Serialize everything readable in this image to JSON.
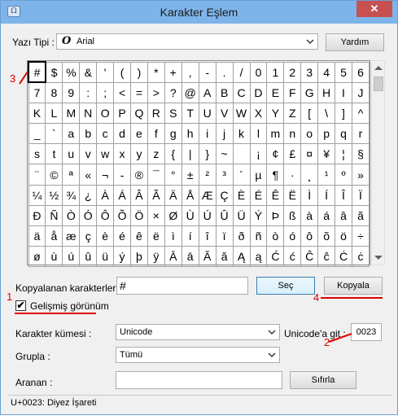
{
  "window": {
    "title": "Karakter Eşlem",
    "icon": "charmap-app-icon",
    "close_glyph": "✕"
  },
  "font": {
    "label": "Yazı Tipi :",
    "selected": "Arial",
    "font_icon_glyph": "O"
  },
  "buttons": {
    "help": "Yardım",
    "select": "Seç",
    "copy": "Kopyala",
    "reset": "Sıfırla"
  },
  "grid": {
    "rows": [
      [
        "!",
        "#",
        "$",
        "%",
        "&",
        "'",
        "(",
        ")",
        "*",
        "+",
        ",",
        "-",
        ".",
        "/",
        "0",
        "1",
        "2",
        "3",
        "4",
        "5",
        "6"
      ],
      [
        "7",
        "8",
        "9",
        ":",
        ";",
        "<",
        "=",
        ">",
        "?",
        "@",
        "A",
        "B",
        "C",
        "D",
        "E",
        "F",
        "G",
        "H",
        "I",
        "J"
      ],
      [
        "K",
        "L",
        "M",
        "N",
        "O",
        "P",
        "Q",
        "R",
        "S",
        "T",
        "U",
        "V",
        "W",
        "X",
        "Y",
        "Z",
        "[",
        "\\",
        "]",
        "^"
      ],
      [
        "_",
        "`",
        "a",
        "b",
        "c",
        "d",
        "e",
        "f",
        "g",
        "h",
        "i",
        "j",
        "k",
        "l",
        "m",
        "n",
        "o",
        "p",
        "q",
        "r"
      ],
      [
        "s",
        "t",
        "u",
        "v",
        "w",
        "x",
        "y",
        "z",
        "{",
        "|",
        "}",
        "~",
        " ",
        "¡",
        "¢",
        "£",
        "¤",
        "¥",
        "¦",
        "§"
      ],
      [
        "¨",
        "©",
        "ª",
        "«",
        "¬",
        "-",
        "®",
        "¯",
        "°",
        "±",
        "²",
        "³",
        "´",
        "µ",
        "¶",
        "·",
        "¸",
        "¹",
        "º",
        "»"
      ],
      [
        "¼",
        "½",
        "¾",
        "¿",
        "À",
        "Á",
        "Â",
        "Ã",
        "Ä",
        "Å",
        "Æ",
        "Ç",
        "È",
        "É",
        "Ê",
        "Ë",
        "Ì",
        "Í",
        "Î",
        "Ï"
      ],
      [
        "Ð",
        "Ñ",
        "Ò",
        "Ó",
        "Ô",
        "Õ",
        "Ö",
        "×",
        "Ø",
        "Ù",
        "Ú",
        "Û",
        "Ü",
        "Ý",
        "Þ",
        "ß",
        "à",
        "á",
        "â",
        "ã"
      ],
      [
        "ä",
        "å",
        "æ",
        "ç",
        "è",
        "é",
        "ê",
        "ë",
        "ì",
        "í",
        "î",
        "ï",
        "ð",
        "ñ",
        "ò",
        "ó",
        "ô",
        "õ",
        "ö",
        "÷"
      ],
      [
        "ø",
        "ù",
        "ú",
        "û",
        "ü",
        "ý",
        "þ",
        "ÿ",
        "Ā",
        "ā",
        "Ă",
        "ă",
        "Ą",
        "ą",
        "Ć",
        "ć",
        "Ĉ",
        "ĉ",
        "Ċ",
        "ċ"
      ]
    ],
    "visible_first_row": [
      "#",
      "$",
      "%",
      "&",
      "'",
      "(",
      ")",
      "*",
      "+",
      ",",
      "-",
      ".",
      "/",
      "0",
      "1",
      "2",
      "3",
      "4",
      "5",
      "6"
    ],
    "selected_char": "#"
  },
  "copy": {
    "label": "Kopyalanan karakterler :",
    "value": "#"
  },
  "advanced": {
    "label": "Gelişmiş görünüm",
    "checked": true,
    "check_glyph": "✔"
  },
  "charset": {
    "label": "Karakter kümesi :",
    "selected": "Unicode"
  },
  "goto": {
    "label": "Unicode'a git :",
    "value": "0023"
  },
  "group": {
    "label": "Grupla :",
    "selected": "Tümü"
  },
  "search": {
    "label": "Aranan :",
    "value": ""
  },
  "status": {
    "text": "U+0023: Diyez İşareti"
  },
  "annotations": {
    "n1": "1",
    "n2": "2",
    "n3": "3",
    "n4": "4",
    "color": "#e10000"
  }
}
